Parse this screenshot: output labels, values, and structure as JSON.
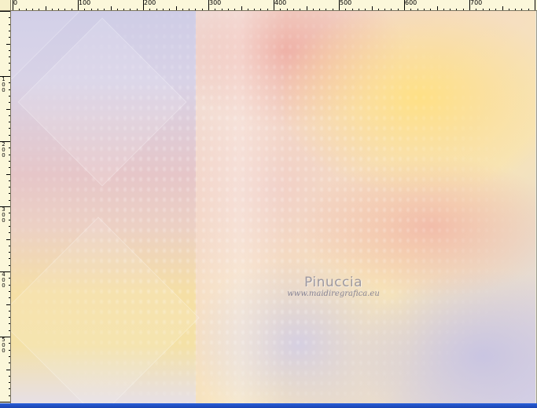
{
  "ruler": {
    "top_labels": [
      "0",
      "100",
      "200",
      "300",
      "400",
      "500",
      "600",
      "700"
    ],
    "left_labels": [
      "1\n0\n0",
      "2\n0\n0",
      "3\n0\n0",
      "4\n0\n0",
      "5\n0\n0"
    ]
  },
  "watermark": {
    "title": "Pinuccia",
    "url": "www.maidiregrafica.eu"
  },
  "colors": {
    "ruler_bg": "#fbf7da",
    "taskbar": "#1a44b0"
  }
}
